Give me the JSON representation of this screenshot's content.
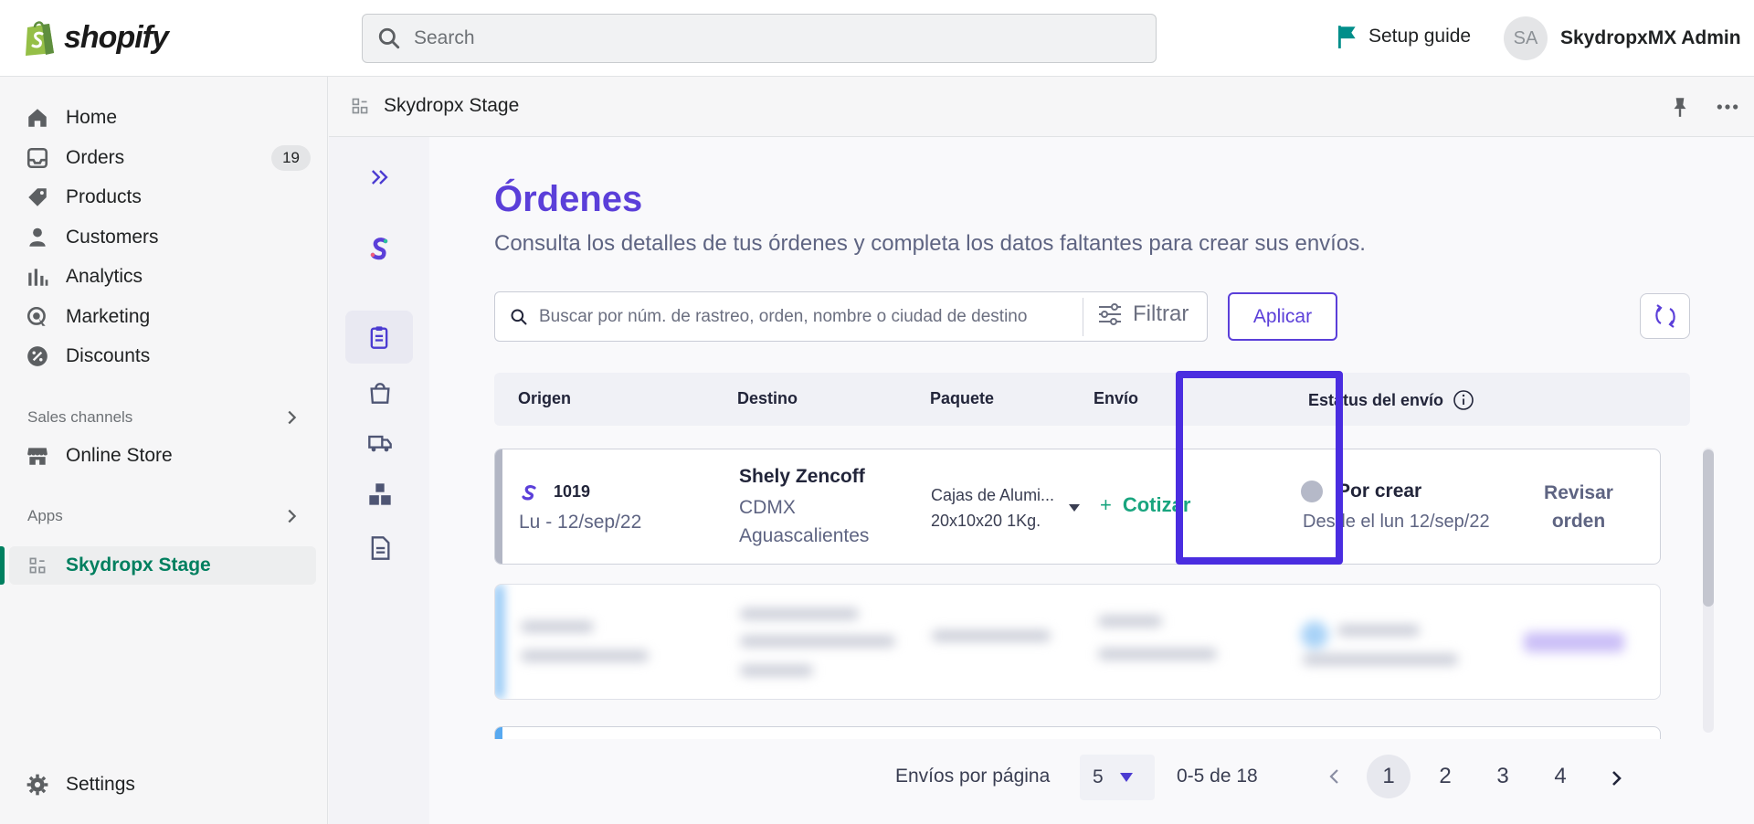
{
  "topbar": {
    "brand": "shopify",
    "search_placeholder": "Search",
    "setup_guide": "Setup guide",
    "user_initials": "SA",
    "user_name": "SkydropxMX Admin"
  },
  "sidebar": {
    "items": [
      {
        "label": "Home",
        "icon": "home-icon"
      },
      {
        "label": "Orders",
        "icon": "orders-icon",
        "badge": "19"
      },
      {
        "label": "Products",
        "icon": "tag-icon"
      },
      {
        "label": "Customers",
        "icon": "person-icon"
      },
      {
        "label": "Analytics",
        "icon": "bar-chart-icon"
      },
      {
        "label": "Marketing",
        "icon": "target-icon"
      },
      {
        "label": "Discounts",
        "icon": "discount-icon"
      }
    ],
    "sales_channels_label": "Sales channels",
    "online_store": "Online Store",
    "apps_label": "Apps",
    "app_item": "Skydropx Stage",
    "settings": "Settings"
  },
  "appbar": {
    "title": "Skydropx Stage"
  },
  "app": {
    "title": "Órdenes",
    "subtitle": "Consulta los detalles de tus órdenes y completa los datos faltantes para crear sus envíos.",
    "filter_placeholder": "Buscar por núm. de rastreo, orden, nombre o ciudad de destino",
    "filter_label": "Filtrar",
    "apply_label": "Aplicar",
    "columns": {
      "origin": "Origen",
      "destination": "Destino",
      "package": "Paquete",
      "shipping": "Envío",
      "status": "Estatus del envío"
    },
    "rows": [
      {
        "order": "1019",
        "date": "Lu - 12/sep/22",
        "dest_name": "Shely Zencoff",
        "dest_city": "CDMX",
        "dest_state": "Aguascalientes",
        "package_name": "Cajas de Alumi...",
        "package_dims": "20x10x20 1Kg.",
        "shipping_action": "Cotizar",
        "status": "Por crear",
        "status_since": "Desde el lun 12/sep/22",
        "review_line1": "Revisar",
        "review_line2": "orden"
      }
    ],
    "pager": {
      "per_page_label": "Envíos por página",
      "per_page_value": "5",
      "range": "0-5 de 18",
      "pages": [
        "1",
        "2",
        "3",
        "4"
      ],
      "current": "1"
    },
    "colors": {
      "accent": "#5b3fd9",
      "success": "#19a57f",
      "highlight": "#4a2de0"
    }
  }
}
